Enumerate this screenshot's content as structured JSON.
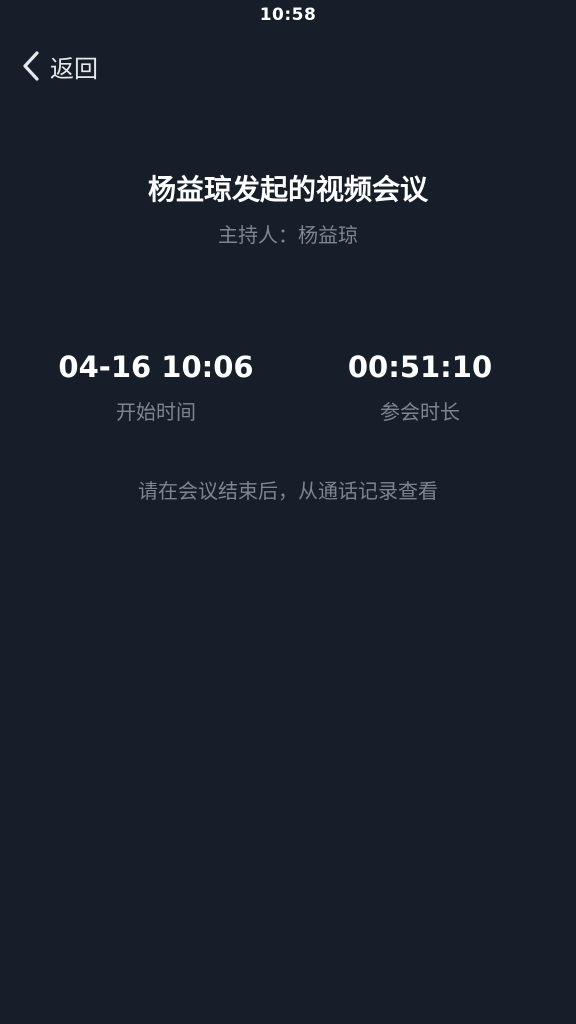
{
  "status_bar": {
    "time": "10:58"
  },
  "nav": {
    "back_icon": "chevron-left-icon",
    "back_label": "返回"
  },
  "meeting": {
    "title": "杨益琼发起的视频会议",
    "host_line": "主持人：杨益琼"
  },
  "stats": {
    "start_time": {
      "value": "04-16 10:06",
      "label": "开始时间"
    },
    "duration": {
      "value": "00:51:10",
      "label": "参会时长"
    }
  },
  "hint": "请在会议结束后，从通话记录查看",
  "colors": {
    "background": "#161e29",
    "primary_text": "#ffffff",
    "secondary_text": "#7d8590"
  }
}
